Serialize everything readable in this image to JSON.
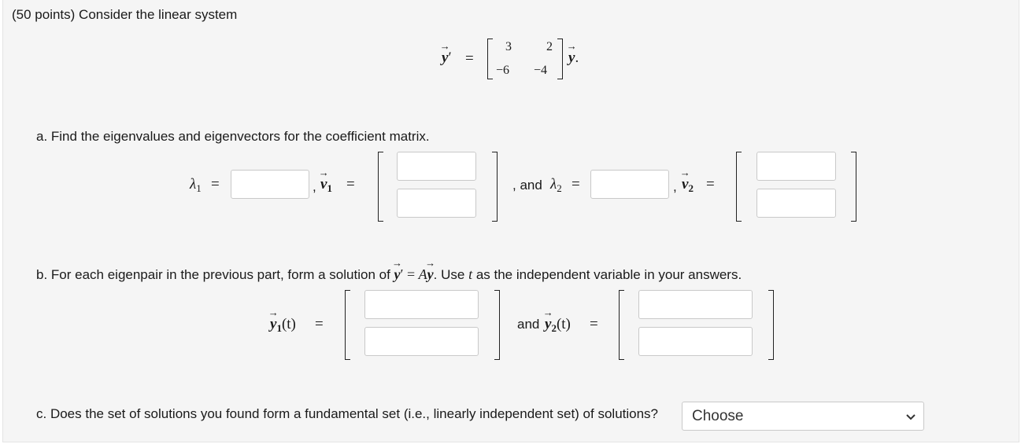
{
  "header": {
    "text": "(50 points) Consider the linear system"
  },
  "system": {
    "lhs": "y",
    "prime": "′",
    "equals": "=",
    "matrix": [
      "3",
      "2",
      "−6",
      "−4"
    ],
    "rhs": "y",
    "period": "."
  },
  "part_a": {
    "prompt": "a. Find the eigenvalues and eigenvectors for the coefficient matrix.",
    "lambda": "λ",
    "one": "1",
    "two": "2",
    "equals": "=",
    "comma": ",",
    "v": "v",
    "and_text": ", and",
    "lambda1_value": "",
    "v1_values": [
      "",
      ""
    ],
    "lambda2_value": "",
    "v2_values": [
      "",
      ""
    ]
  },
  "part_b": {
    "prompt_pre": "b. For each eigenpair in the previous part, form a solution of",
    "prompt_eq": "=",
    "prompt_A": "A",
    "prompt_mid": ". Use",
    "prompt_t": "t",
    "prompt_post": "as the independent variable in your answers.",
    "y": "y",
    "targ": "(t)",
    "and_text": "and",
    "y1_values": [
      "",
      ""
    ],
    "y2_values": [
      "",
      ""
    ]
  },
  "part_c": {
    "prompt": "c. Does the set of solutions you found form a fundamental set (i.e., linearly independent set) of solutions?",
    "select_value": "Choose"
  }
}
